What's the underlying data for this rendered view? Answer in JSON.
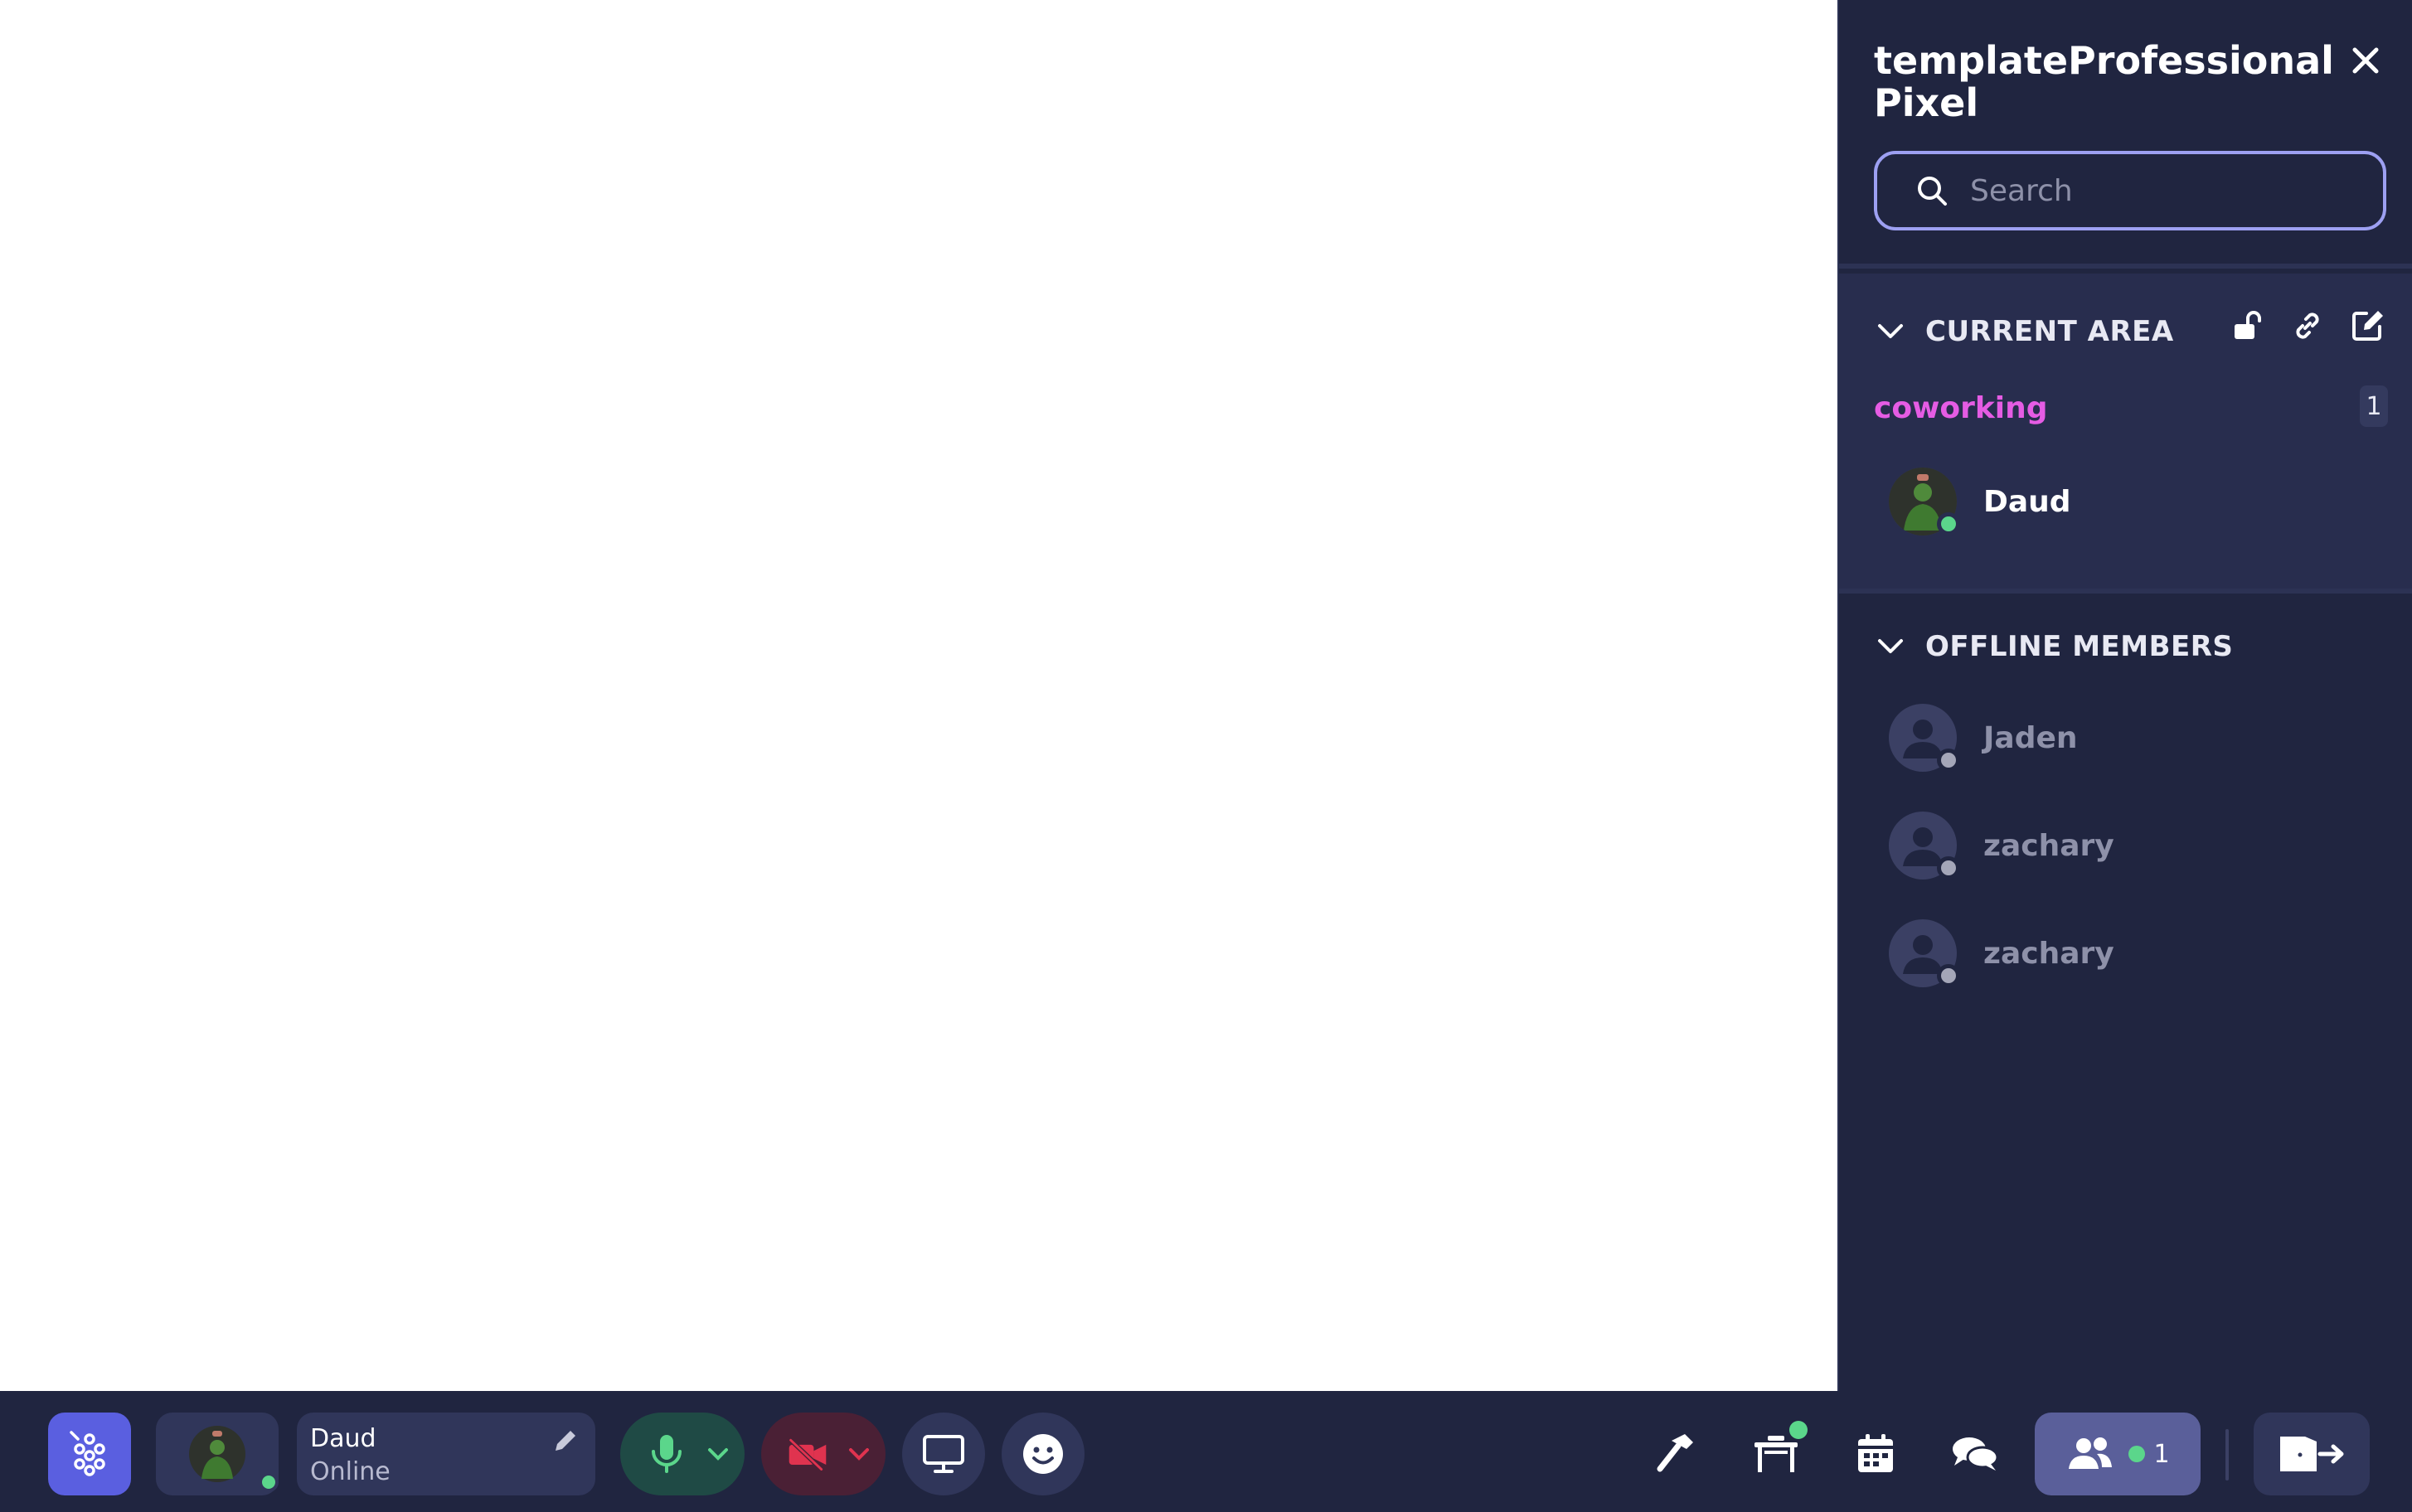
{
  "panel": {
    "title": "templateProfessionalPixel",
    "search_placeholder": "Search",
    "current_area": {
      "label": "CURRENT AREA",
      "area_name": "coworking",
      "count": "1",
      "members": [
        {
          "name": "Daud",
          "status": "online"
        }
      ]
    },
    "offline": {
      "label": "OFFLINE MEMBERS",
      "members": [
        {
          "name": "Jaden"
        },
        {
          "name": "zachary"
        },
        {
          "name": "zachary"
        }
      ]
    }
  },
  "bottombar": {
    "me": {
      "name": "Daud",
      "status": "Online"
    },
    "people_count": "1"
  },
  "colors": {
    "panel_bg": "#202540",
    "accent": "#5a5fe0",
    "area_name": "#e55ce4",
    "online": "#5bd68b",
    "mic_on": "#5bd68b",
    "cam_off": "#e0334f"
  },
  "icons": [
    "close-icon",
    "search-icon",
    "chevron-down-icon",
    "unlock-icon",
    "link-icon",
    "edit-icon",
    "logo-icon",
    "pencil-icon",
    "microphone-icon",
    "video-off-icon",
    "screen-share-icon",
    "emoji-icon",
    "hammer-icon",
    "desk-icon",
    "calendar-icon",
    "chat-icon",
    "people-icon",
    "leave-icon"
  ]
}
